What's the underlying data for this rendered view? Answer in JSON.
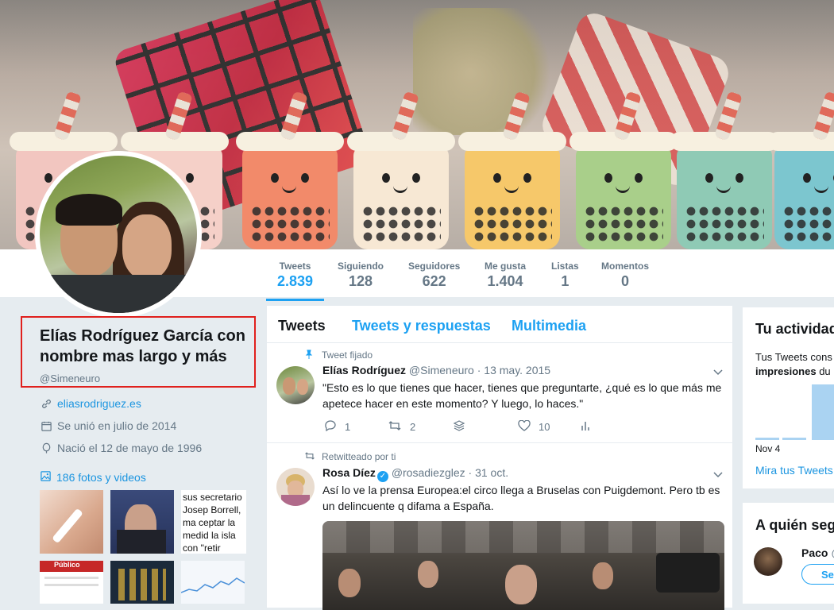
{
  "profile": {
    "name": "Elías Rodríguez García con nombre mas largo y más",
    "handle": "@Simeneuro",
    "website": "eliasrodriguez.es",
    "joined": "Se unió en julio de 2014",
    "born": "Nació el 12 de mayo de 1996",
    "photos_link": "186 fotos y videos"
  },
  "nav": [
    {
      "label": "Tweets",
      "value": "2.839"
    },
    {
      "label": "Siguiendo",
      "value": "128"
    },
    {
      "label": "Seguidores",
      "value": "622"
    },
    {
      "label": "Me gusta",
      "value": "1.404"
    },
    {
      "label": "Listas",
      "value": "1"
    },
    {
      "label": "Momentos",
      "value": "0"
    }
  ],
  "timeline": {
    "tabs": [
      "Tweets",
      "Tweets y respuestas",
      "Multimedia"
    ],
    "tweets": [
      {
        "context": "Tweet fijado",
        "name": "Elías Rodríguez",
        "handle": "@Simeneuro",
        "date": "· 13 may. 2015",
        "text": "\"Esto es lo que tienes que hacer, tienes que preguntarte, ¿qué es lo que más me apetece hacer en este momento? Y luego, lo haces.\"",
        "replies": "1",
        "retweets": "2",
        "likes": "10"
      },
      {
        "context": "Retwitteado por ti",
        "name": "Rosa Díez",
        "handle": "@rosadiezglez",
        "date": "· 31 oct.",
        "text": "Así lo ve la prensa Europea:el circo llega a Bruselas con Puigdemont. Pero tb es un delincuente q difama a España."
      }
    ]
  },
  "thumbs": [
    {
      "text": "sus secretario Josep Borrell, ma ceptar la medid la isla con \"retir Tratado europe"
    },
    {
      "text": "Público"
    }
  ],
  "activity": {
    "title": "Tu actividad",
    "line1": "Tus Tweets cons",
    "line2_bold": "impresiones",
    "line2_rest": " du",
    "date_label": "Nov 4",
    "link": "Mira tus Tweets"
  },
  "follow": {
    "title": "A quién seg",
    "user": "Paco",
    "user_suffix": "@",
    "button": "Se"
  },
  "colors": {
    "accent": "#1da1f2",
    "highlight_border": "#e0201d",
    "background": "#e6ecf0"
  }
}
